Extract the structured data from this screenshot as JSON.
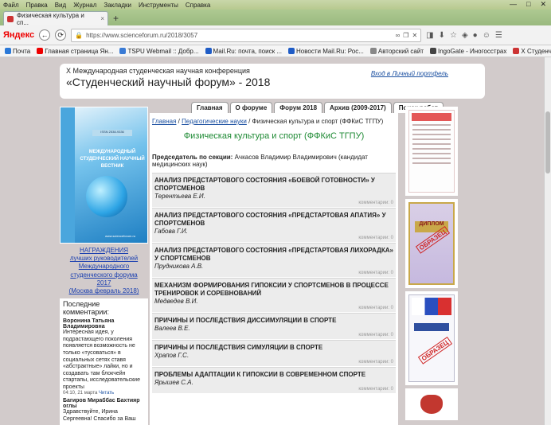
{
  "menu": {
    "items": [
      "Файл",
      "Правка",
      "Вид",
      "Журнал",
      "Закладки",
      "Инструменты",
      "Справка"
    ],
    "win_controls": [
      "—",
      "□",
      "✕"
    ]
  },
  "tab": {
    "title": "Физическая культура и сп...",
    "close": "×",
    "new_tab": "+"
  },
  "address_bar": {
    "brand": "Яндекс",
    "url": "https://www.scienceforum.ru/2018/3057"
  },
  "bookmarks": [
    {
      "label": "Почта",
      "color": "#2b79d8"
    },
    {
      "label": "Главная страница Ян...",
      "color": "#e00"
    },
    {
      "label": "TSPU Webmail :: Добр...",
      "color": "#3a7bd5"
    },
    {
      "label": "Mail.Ru: почта, поиск ...",
      "color": "#1f5cc6"
    },
    {
      "label": "Новости Mail.Ru: Рос...",
      "color": "#1f5cc6"
    },
    {
      "label": "Авторский сайт",
      "color": "#888"
    },
    {
      "label": "IngoGate - Иногосстрах",
      "color": "#444"
    },
    {
      "label": "X Студенческий науч...",
      "color": "#c33"
    }
  ],
  "header": {
    "conference": "X Международная студенческая научная конференция",
    "forum": "«Студенческий научный форум» - 2018",
    "login": "Вход в Личный портфель"
  },
  "nav": [
    "Главная",
    "О форуме",
    "Форум 2018",
    "Архив (2009-2017)",
    "Поиск работ"
  ],
  "cover": {
    "issn": "ISSN 2538-9336",
    "title": "МЕЖДУНАРОДНЫЙ СТУДЕНЧЕСКИЙ НАУЧНЫЙ ВЕСТНИК",
    "publisher": "www.scienceforum.ru"
  },
  "awards": {
    "line1": "НАГРАЖДЕНИЯ",
    "line2": "лучших руководителей",
    "line3": "Международного",
    "line4": "студенческого форума",
    "line5": "2017",
    "line6": "(Москва февраль 2018)"
  },
  "recent_comments": {
    "heading": "Последние комментарии:",
    "items": [
      {
        "author": "Воронина Татьяна Владимировна",
        "text": "Интересная идея, у подрастающего поколения появляется возможность не только «тусоваться» в социальных сетях ставя «абстрактные» лайки, но и создавать там блокчейн стартапы, исследовательские проекты",
        "date": "04:10, 21 марта",
        "read": "Читать"
      },
      {
        "author": "Багиров Мираббас Бахтияр оглы",
        "text": "Здравствуйте, Ирина Сергеевна! Спасибо за Ваш",
        "date": "",
        "read": ""
      }
    ]
  },
  "breadcrumbs": {
    "home": "Главная",
    "sep1": " / ",
    "category": "Педагогические науки",
    "sep2": " / ",
    "current": "Физическая культура и спорт (ФФКиС ТГПУ)"
  },
  "section": {
    "title": "Физическая культура и спорт (ФФКиС ТГПУ)",
    "chair_label": "Председатель по секции:",
    "chair_name": " Ачкасов Владимир Владимирович (кандидат медицинских наук)"
  },
  "articles": [
    {
      "title": "АНАЛИЗ ПРЕДСТАРТОВОГО СОСТОЯНИЯ «БОЕВОЙ ГОТОВНОСТИ» У СПОРТСМЕНОВ",
      "author": "Терентьева Е.И.",
      "comments": "комментарии: 0"
    },
    {
      "title": "АНАЛИЗ ПРЕДСТАРТОВОГО СОСТОЯНИЯ «ПРЕДСТАРТОВАЯ АПАТИЯ» У СПОРТСМЕНОВ",
      "author": "Габова Г.И.",
      "comments": "комментарии: 0"
    },
    {
      "title": "АНАЛИЗ ПРЕДСТАРТОВОГО СОСТОЯНИЯ «ПРЕДСТАРТОВАЯ ЛИХОРАДКА» У СПОРТСМЕНОВ",
      "author": "Прудникова А.В.",
      "comments": "комментарии: 0"
    },
    {
      "title": "МЕХАНИЗМ ФОРМИРОВАНИЯ ГИПОКСИИ У СПОРТСМЕНОВ В ПРОЦЕССЕ ТРЕНИРОВОК И СОРЕВНОВАНИЙ",
      "author": "Медведев В.И.",
      "comments": "комментарии: 0"
    },
    {
      "title": "ПРИЧИНЫ И ПОСЛЕДСТВИЯ ДИССИМУЛЯЦИИ В СПОРТЕ",
      "author": "Валеев В.Е.",
      "comments": "комментарии: 0"
    },
    {
      "title": "ПРИЧИНЫ И ПОСЛЕДСТВИЯ СИМУЛЯЦИИ В СПОРТЕ",
      "author": "Храпов Г.С.",
      "comments": "комментарии: 0"
    },
    {
      "title": "ПРОБЛЕМЫ АДАПТАЦИИ К ГИПОКСИИ В СОВРЕМЕННОМ СПОРТЕ",
      "author": "Ярышев С.А.",
      "comments": "комментарии: 0"
    }
  ],
  "right_images": {
    "diploma_text": "ДИПЛОМ",
    "stamp": "ОБРАЗЕЦ"
  },
  "colors": {
    "section_title": "#1e8a34",
    "link": "#1a4fa0",
    "page_bg": "#d2cbcb"
  }
}
